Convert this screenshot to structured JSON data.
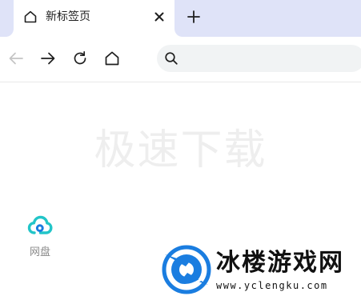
{
  "tab": {
    "title": "新标签页",
    "icon": "home-icon"
  },
  "toolbar": {
    "back_icon": "arrow-left-icon",
    "forward_icon": "arrow-right-icon",
    "reload_icon": "reload-icon",
    "home_icon": "home-icon",
    "address": {
      "value": "",
      "placeholder": ""
    }
  },
  "content": {
    "watermark_title": "极速下载",
    "shortcuts": [
      {
        "label": "网盘",
        "icon": "cloud-icon"
      }
    ]
  },
  "site_logo": {
    "name": "冰楼游戏网",
    "url": "www.yclengku.com"
  },
  "colors": {
    "tabstrip_bg": "#dfe3f8",
    "cloud_accent": "#22c5c8",
    "logo_blue": "#1a7de0"
  }
}
